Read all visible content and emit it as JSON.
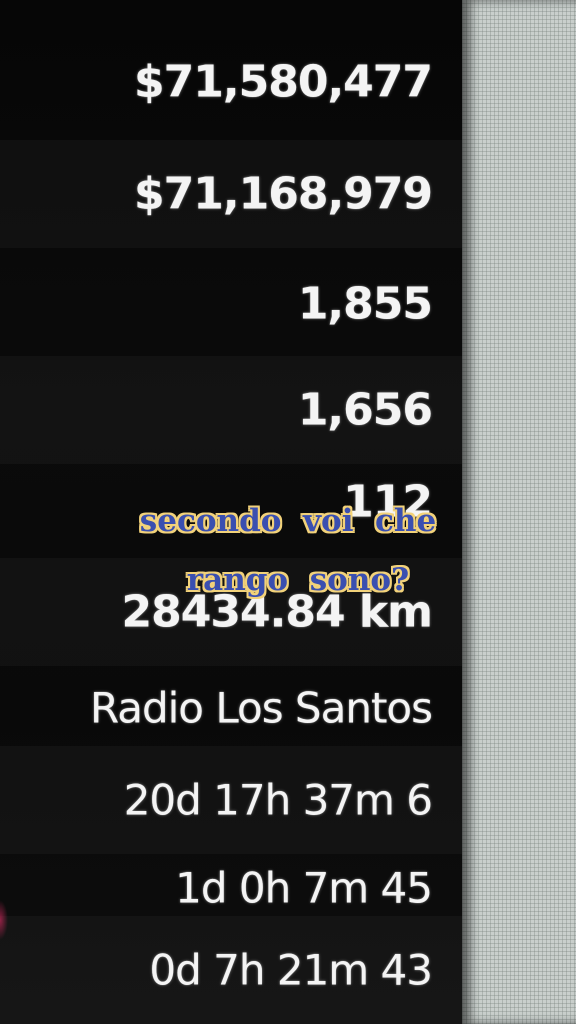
{
  "stats": {
    "values": [
      "$71,580,477",
      "$71,168,979",
      "1,855",
      "1,656",
      "112",
      "28434.84 km",
      "Radio Los Santos",
      "20d 17h 37m 6",
      "1d 0h 7m 45",
      "0d 7h 21m 43"
    ]
  },
  "caption": {
    "line1": "secondo  voi  che",
    "line2": "rango  sono?"
  },
  "colors": {
    "caption_text": "#3a4fb0",
    "caption_outline": "#f2d27a",
    "panel_background": "#070707",
    "value_text": "#f4f4f4"
  }
}
